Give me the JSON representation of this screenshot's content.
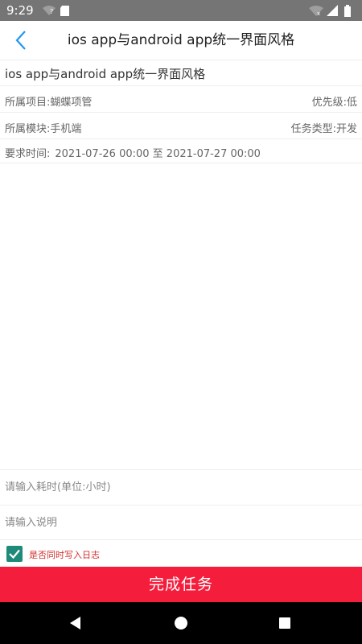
{
  "status_bar": {
    "time": "9:29",
    "left_icons": [
      "wifi-question-icon",
      "sd-card-icon"
    ],
    "right_icons": [
      "wifi-off-icon",
      "signal-icon",
      "battery-icon"
    ]
  },
  "nav": {
    "back_icon": "chevron-left-icon",
    "title": "ios app与android app统一界面风格"
  },
  "task": {
    "name": "ios app与android app统一界面风格",
    "project_label": "所属项目:",
    "project_value": "蝴蝶项管",
    "priority_label": "优先级:",
    "priority_value": "低",
    "module_label": "所属模块:",
    "module_value": "手机端",
    "type_label": "任务类型:",
    "type_value": "开发",
    "time_label": "要求时间:",
    "time_value": "2021-07-26 00:00 至 2021-07-27 00:00"
  },
  "form": {
    "hours_placeholder": "请输入耗时(单位:小时)",
    "hours_value": "",
    "desc_placeholder": "请输入说明",
    "desc_value": "",
    "log_checked": true,
    "log_label": "是否同时写入日志"
  },
  "actions": {
    "complete_label": "完成任务"
  },
  "colors": {
    "status_bar": "#757575",
    "accent_blue": "#2196f3",
    "checkbox": "#1e8a7a",
    "log_label": "#d32f2f",
    "complete_button": "#f41e3c"
  },
  "system_nav": [
    "back-triangle-icon",
    "home-circle-icon",
    "recents-square-icon"
  ]
}
